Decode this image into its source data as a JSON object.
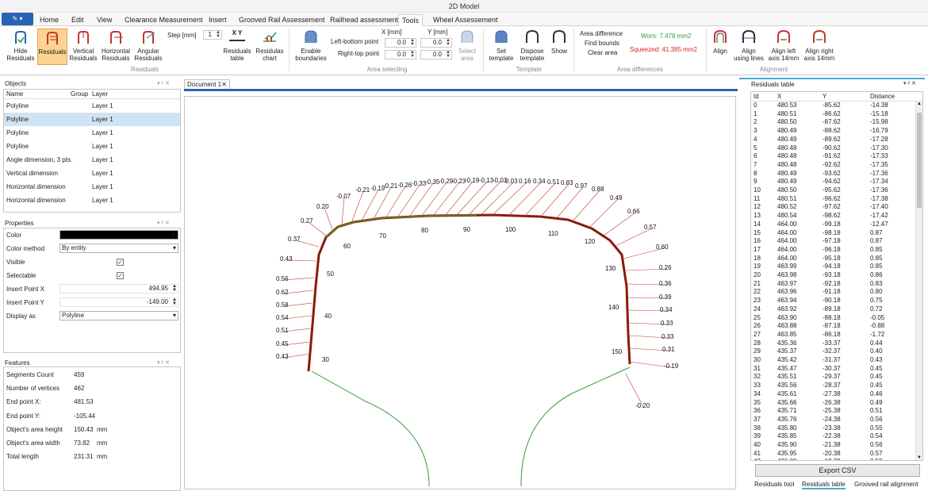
{
  "window": {
    "title": "2D Model"
  },
  "menu": {
    "app_button": "✎ ▾",
    "tabs": [
      "Home",
      "Edit",
      "View",
      "Clearance Measurement",
      "Insert",
      "Grooved Rail Assessement",
      "Railhead assessment",
      "Tools",
      "Wheel Assessement"
    ],
    "active_tab": "Tools"
  },
  "ribbon": {
    "residuals": {
      "hide": "HIde\nResiduals",
      "residuals": "Residuals",
      "vertical": "Vertical\nResiduals",
      "horizontal": "Horizontal\nResiduals",
      "angular": "Angular\nResiduals",
      "step_label": "Step [mm]",
      "step_value": "1",
      "table": "Residuals\ntable",
      "chart": "Residulas\nchart",
      "table_icon_text": "X Y",
      "group": "Residuals"
    },
    "area": {
      "enable": "Enable\nboundaries",
      "x_header": "X [mm]",
      "y_header": "Y [mm]",
      "left_bottom": "Left-bottom point",
      "right_top": "Right-top point",
      "lb_x": "0.0",
      "lb_y": "0.0",
      "rt_x": "0.0",
      "rt_y": "0.0",
      "select": "Select\narea",
      "group": "Area selecting"
    },
    "template": {
      "set": "Set\ntemplate",
      "dispose": "Dispose\ntemplate",
      "show": "Show",
      "group": "Template"
    },
    "area_diff": {
      "difference": "Area difference",
      "find": "Find bounds",
      "clear": "Clear area",
      "worn": "Worn:  7.478 mm2",
      "squeezed": "Squeezed:  41.385 mm2",
      "group": "Area differences",
      "worn_color": "#2a9d3a",
      "squeezed_color": "#d42424"
    },
    "alignment": {
      "align": "Align",
      "align_lines": "Align\nusing lines",
      "align_left": "Align left\naxis 14mm",
      "align_right": "Align right\naxis 14mm",
      "group": "Alignment"
    }
  },
  "objects_panel": {
    "title": "Objects",
    "columns": [
      "Name",
      "Group",
      "Layer"
    ],
    "rows": [
      {
        "name": "Polyline",
        "group": "",
        "layer": "Layer 1"
      },
      {
        "name": "Polyline",
        "group": "",
        "layer": "Layer 1"
      },
      {
        "name": "Polyline",
        "group": "",
        "layer": "Layer 1"
      },
      {
        "name": "Polyline",
        "group": "",
        "layer": "Layer 1"
      },
      {
        "name": "Angle dimension, 3 pts.",
        "group": "",
        "layer": "Layer 1"
      },
      {
        "name": "Vertical dimension",
        "group": "",
        "layer": "Layer 1"
      },
      {
        "name": "Horizontal dimension",
        "group": "",
        "layer": "Layer 1"
      },
      {
        "name": "Horizontal dimension",
        "group": "",
        "layer": "Layer 1"
      }
    ],
    "selected_index": 1
  },
  "properties_panel": {
    "title": "Properties",
    "color_label": "Color",
    "color_value": "#000000",
    "color_method_label": "Color method",
    "color_method_value": "By entity",
    "visible_label": "Visible",
    "visible": true,
    "selectable_label": "Selectable",
    "selectable": true,
    "insert_x_label": "Insert Point X",
    "insert_x_value": "494.95",
    "insert_y_label": "Insert Point Y",
    "insert_y_value": "-149.00",
    "display_label": "Display as",
    "display_value": "Polyline"
  },
  "features_panel": {
    "title": "Features",
    "rows": [
      {
        "label": "Segments Count",
        "value": "459",
        "unit": ""
      },
      {
        "label": "Number of vertices",
        "value": "462",
        "unit": ""
      },
      {
        "label": "End point X:",
        "value": "481.53",
        "unit": ""
      },
      {
        "label": "End point Y:",
        "value": "-105.44",
        "unit": ""
      },
      {
        "label": "Object's area height",
        "value": "150.43",
        "unit": "mm"
      },
      {
        "label": "Object's area width",
        "value": "73.82",
        "unit": "mm"
      },
      {
        "label": "Total length",
        "value": "231.31",
        "unit": "mm"
      }
    ]
  },
  "document": {
    "tab": "Document 1",
    "angle_labels": [
      "30",
      "40",
      "50",
      "60",
      "70",
      "80",
      "90",
      "100",
      "110",
      "120",
      "130",
      "140",
      "150"
    ],
    "residual_labels": [
      "0.43",
      "0.45",
      "0.51",
      "0.54",
      "0.58",
      "0.62",
      "0.56",
      "0.43",
      "0.37",
      "0.27",
      "0.20",
      "-0.07",
      "-0.21",
      "-0.19",
      "-0.21",
      "-0.26",
      "-0.33",
      "-0.35",
      "-0.29",
      "-0.23",
      "-0.19",
      "-0.13",
      "-0.03",
      "0.03",
      "0.16",
      "0.34",
      "0.51",
      "0.83",
      "0.97",
      "0.88",
      "0.49",
      "0.66",
      "0.57",
      "0.60",
      "0.26",
      "0.36",
      "0.39",
      "0.34",
      "0.33",
      "0.33",
      "0.31",
      "-0.19",
      "-0.20"
    ]
  },
  "residuals_table": {
    "title": "Residuals table",
    "columns": [
      "Id",
      "X",
      "Y",
      "Distance"
    ],
    "rows": [
      [
        "0",
        "480.53",
        "-85.62",
        "-14.38"
      ],
      [
        "1",
        "480.51",
        "-86.62",
        "-15.18"
      ],
      [
        "2",
        "480.50",
        "-87.62",
        "-15.98"
      ],
      [
        "3",
        "480.49",
        "-88.62",
        "-16.79"
      ],
      [
        "4",
        "480.49",
        "-89.62",
        "-17.28"
      ],
      [
        "5",
        "480.48",
        "-90.62",
        "-17.30"
      ],
      [
        "6",
        "480.48",
        "-91.62",
        "-17.33"
      ],
      [
        "7",
        "480.48",
        "-92.62",
        "-17.35"
      ],
      [
        "8",
        "480.49",
        "-93.62",
        "-17.36"
      ],
      [
        "9",
        "480.49",
        "-94.62",
        "-17.34"
      ],
      [
        "10",
        "480.50",
        "-95.62",
        "-17.36"
      ],
      [
        "11",
        "480.51",
        "-96.62",
        "-17.38"
      ],
      [
        "12",
        "480.52",
        "-97.62",
        "-17.40"
      ],
      [
        "13",
        "480.54",
        "-98.62",
        "-17.42"
      ],
      [
        "14",
        "464.00",
        "-99.18",
        "-12.47"
      ],
      [
        "15",
        "464.00",
        "-98.18",
        "0.87"
      ],
      [
        "16",
        "464.00",
        "-97.18",
        "0.87"
      ],
      [
        "17",
        "464.00",
        "-96.18",
        "0.85"
      ],
      [
        "18",
        "464.00",
        "-95.18",
        "0.85"
      ],
      [
        "19",
        "463.99",
        "-94.18",
        "0.85"
      ],
      [
        "20",
        "463.98",
        "-93.18",
        "0.86"
      ],
      [
        "21",
        "463.97",
        "-92.18",
        "0.83"
      ],
      [
        "22",
        "463.96",
        "-91.18",
        "0.80"
      ],
      [
        "23",
        "463.94",
        "-90.18",
        "0.75"
      ],
      [
        "24",
        "463.92",
        "-89.18",
        "0.72"
      ],
      [
        "25",
        "463.90",
        "-88.18",
        "-0.05"
      ],
      [
        "26",
        "463.88",
        "-87.18",
        "-0.88"
      ],
      [
        "27",
        "463.85",
        "-86.18",
        "-1.72"
      ],
      [
        "28",
        "435.36",
        "-33.37",
        "0.44"
      ],
      [
        "29",
        "435.37",
        "-32.37",
        "0.40"
      ],
      [
        "30",
        "435.42",
        "-31.37",
        "0.43"
      ],
      [
        "31",
        "435.47",
        "-30.37",
        "0.45"
      ],
      [
        "32",
        "435.51",
        "-29.37",
        "0.45"
      ],
      [
        "33",
        "435.56",
        "-28.37",
        "0.45"
      ],
      [
        "34",
        "435.61",
        "-27.38",
        "0.46"
      ],
      [
        "35",
        "435.66",
        "-26.38",
        "0.49"
      ],
      [
        "36",
        "435.71",
        "-25.38",
        "0.51"
      ],
      [
        "37",
        "435.76",
        "-24.38",
        "0.56"
      ],
      [
        "38",
        "435.80",
        "-23.38",
        "0.55"
      ],
      [
        "39",
        "435.85",
        "-22.38",
        "0.54"
      ],
      [
        "40",
        "435.90",
        "-21.38",
        "0.56"
      ],
      [
        "41",
        "435.95",
        "-20.38",
        "0.57"
      ],
      [
        "42",
        "436.00",
        "-19.39",
        "0.58"
      ]
    ],
    "export_button": "Export CSV",
    "bottom_tabs": [
      "Residuals tool",
      "Residuals table",
      "Grooved rail alignment"
    ],
    "active_bottom_tab": "Residuals table"
  }
}
